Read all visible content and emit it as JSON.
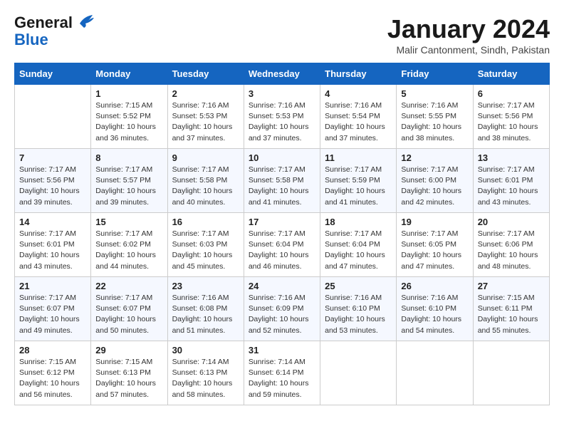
{
  "header": {
    "logo_line1": "General",
    "logo_line2": "Blue",
    "month": "January 2024",
    "location": "Malir Cantonment, Sindh, Pakistan"
  },
  "days_of_week": [
    "Sunday",
    "Monday",
    "Tuesday",
    "Wednesday",
    "Thursday",
    "Friday",
    "Saturday"
  ],
  "weeks": [
    [
      {
        "day": null
      },
      {
        "day": 1,
        "sunrise": "7:15 AM",
        "sunset": "5:52 PM",
        "daylight": "10 hours and 36 minutes."
      },
      {
        "day": 2,
        "sunrise": "7:16 AM",
        "sunset": "5:53 PM",
        "daylight": "10 hours and 37 minutes."
      },
      {
        "day": 3,
        "sunrise": "7:16 AM",
        "sunset": "5:53 PM",
        "daylight": "10 hours and 37 minutes."
      },
      {
        "day": 4,
        "sunrise": "7:16 AM",
        "sunset": "5:54 PM",
        "daylight": "10 hours and 37 minutes."
      },
      {
        "day": 5,
        "sunrise": "7:16 AM",
        "sunset": "5:55 PM",
        "daylight": "10 hours and 38 minutes."
      },
      {
        "day": 6,
        "sunrise": "7:17 AM",
        "sunset": "5:56 PM",
        "daylight": "10 hours and 38 minutes."
      }
    ],
    [
      {
        "day": 7,
        "sunrise": "7:17 AM",
        "sunset": "5:56 PM",
        "daylight": "10 hours and 39 minutes."
      },
      {
        "day": 8,
        "sunrise": "7:17 AM",
        "sunset": "5:57 PM",
        "daylight": "10 hours and 39 minutes."
      },
      {
        "day": 9,
        "sunrise": "7:17 AM",
        "sunset": "5:58 PM",
        "daylight": "10 hours and 40 minutes."
      },
      {
        "day": 10,
        "sunrise": "7:17 AM",
        "sunset": "5:58 PM",
        "daylight": "10 hours and 41 minutes."
      },
      {
        "day": 11,
        "sunrise": "7:17 AM",
        "sunset": "5:59 PM",
        "daylight": "10 hours and 41 minutes."
      },
      {
        "day": 12,
        "sunrise": "7:17 AM",
        "sunset": "6:00 PM",
        "daylight": "10 hours and 42 minutes."
      },
      {
        "day": 13,
        "sunrise": "7:17 AM",
        "sunset": "6:01 PM",
        "daylight": "10 hours and 43 minutes."
      }
    ],
    [
      {
        "day": 14,
        "sunrise": "7:17 AM",
        "sunset": "6:01 PM",
        "daylight": "10 hours and 43 minutes."
      },
      {
        "day": 15,
        "sunrise": "7:17 AM",
        "sunset": "6:02 PM",
        "daylight": "10 hours and 44 minutes."
      },
      {
        "day": 16,
        "sunrise": "7:17 AM",
        "sunset": "6:03 PM",
        "daylight": "10 hours and 45 minutes."
      },
      {
        "day": 17,
        "sunrise": "7:17 AM",
        "sunset": "6:04 PM",
        "daylight": "10 hours and 46 minutes."
      },
      {
        "day": 18,
        "sunrise": "7:17 AM",
        "sunset": "6:04 PM",
        "daylight": "10 hours and 47 minutes."
      },
      {
        "day": 19,
        "sunrise": "7:17 AM",
        "sunset": "6:05 PM",
        "daylight": "10 hours and 47 minutes."
      },
      {
        "day": 20,
        "sunrise": "7:17 AM",
        "sunset": "6:06 PM",
        "daylight": "10 hours and 48 minutes."
      }
    ],
    [
      {
        "day": 21,
        "sunrise": "7:17 AM",
        "sunset": "6:07 PM",
        "daylight": "10 hours and 49 minutes."
      },
      {
        "day": 22,
        "sunrise": "7:17 AM",
        "sunset": "6:07 PM",
        "daylight": "10 hours and 50 minutes."
      },
      {
        "day": 23,
        "sunrise": "7:16 AM",
        "sunset": "6:08 PM",
        "daylight": "10 hours and 51 minutes."
      },
      {
        "day": 24,
        "sunrise": "7:16 AM",
        "sunset": "6:09 PM",
        "daylight": "10 hours and 52 minutes."
      },
      {
        "day": 25,
        "sunrise": "7:16 AM",
        "sunset": "6:10 PM",
        "daylight": "10 hours and 53 minutes."
      },
      {
        "day": 26,
        "sunrise": "7:16 AM",
        "sunset": "6:10 PM",
        "daylight": "10 hours and 54 minutes."
      },
      {
        "day": 27,
        "sunrise": "7:15 AM",
        "sunset": "6:11 PM",
        "daylight": "10 hours and 55 minutes."
      }
    ],
    [
      {
        "day": 28,
        "sunrise": "7:15 AM",
        "sunset": "6:12 PM",
        "daylight": "10 hours and 56 minutes."
      },
      {
        "day": 29,
        "sunrise": "7:15 AM",
        "sunset": "6:13 PM",
        "daylight": "10 hours and 57 minutes."
      },
      {
        "day": 30,
        "sunrise": "7:14 AM",
        "sunset": "6:13 PM",
        "daylight": "10 hours and 58 minutes."
      },
      {
        "day": 31,
        "sunrise": "7:14 AM",
        "sunset": "6:14 PM",
        "daylight": "10 hours and 59 minutes."
      },
      {
        "day": null
      },
      {
        "day": null
      },
      {
        "day": null
      }
    ]
  ]
}
